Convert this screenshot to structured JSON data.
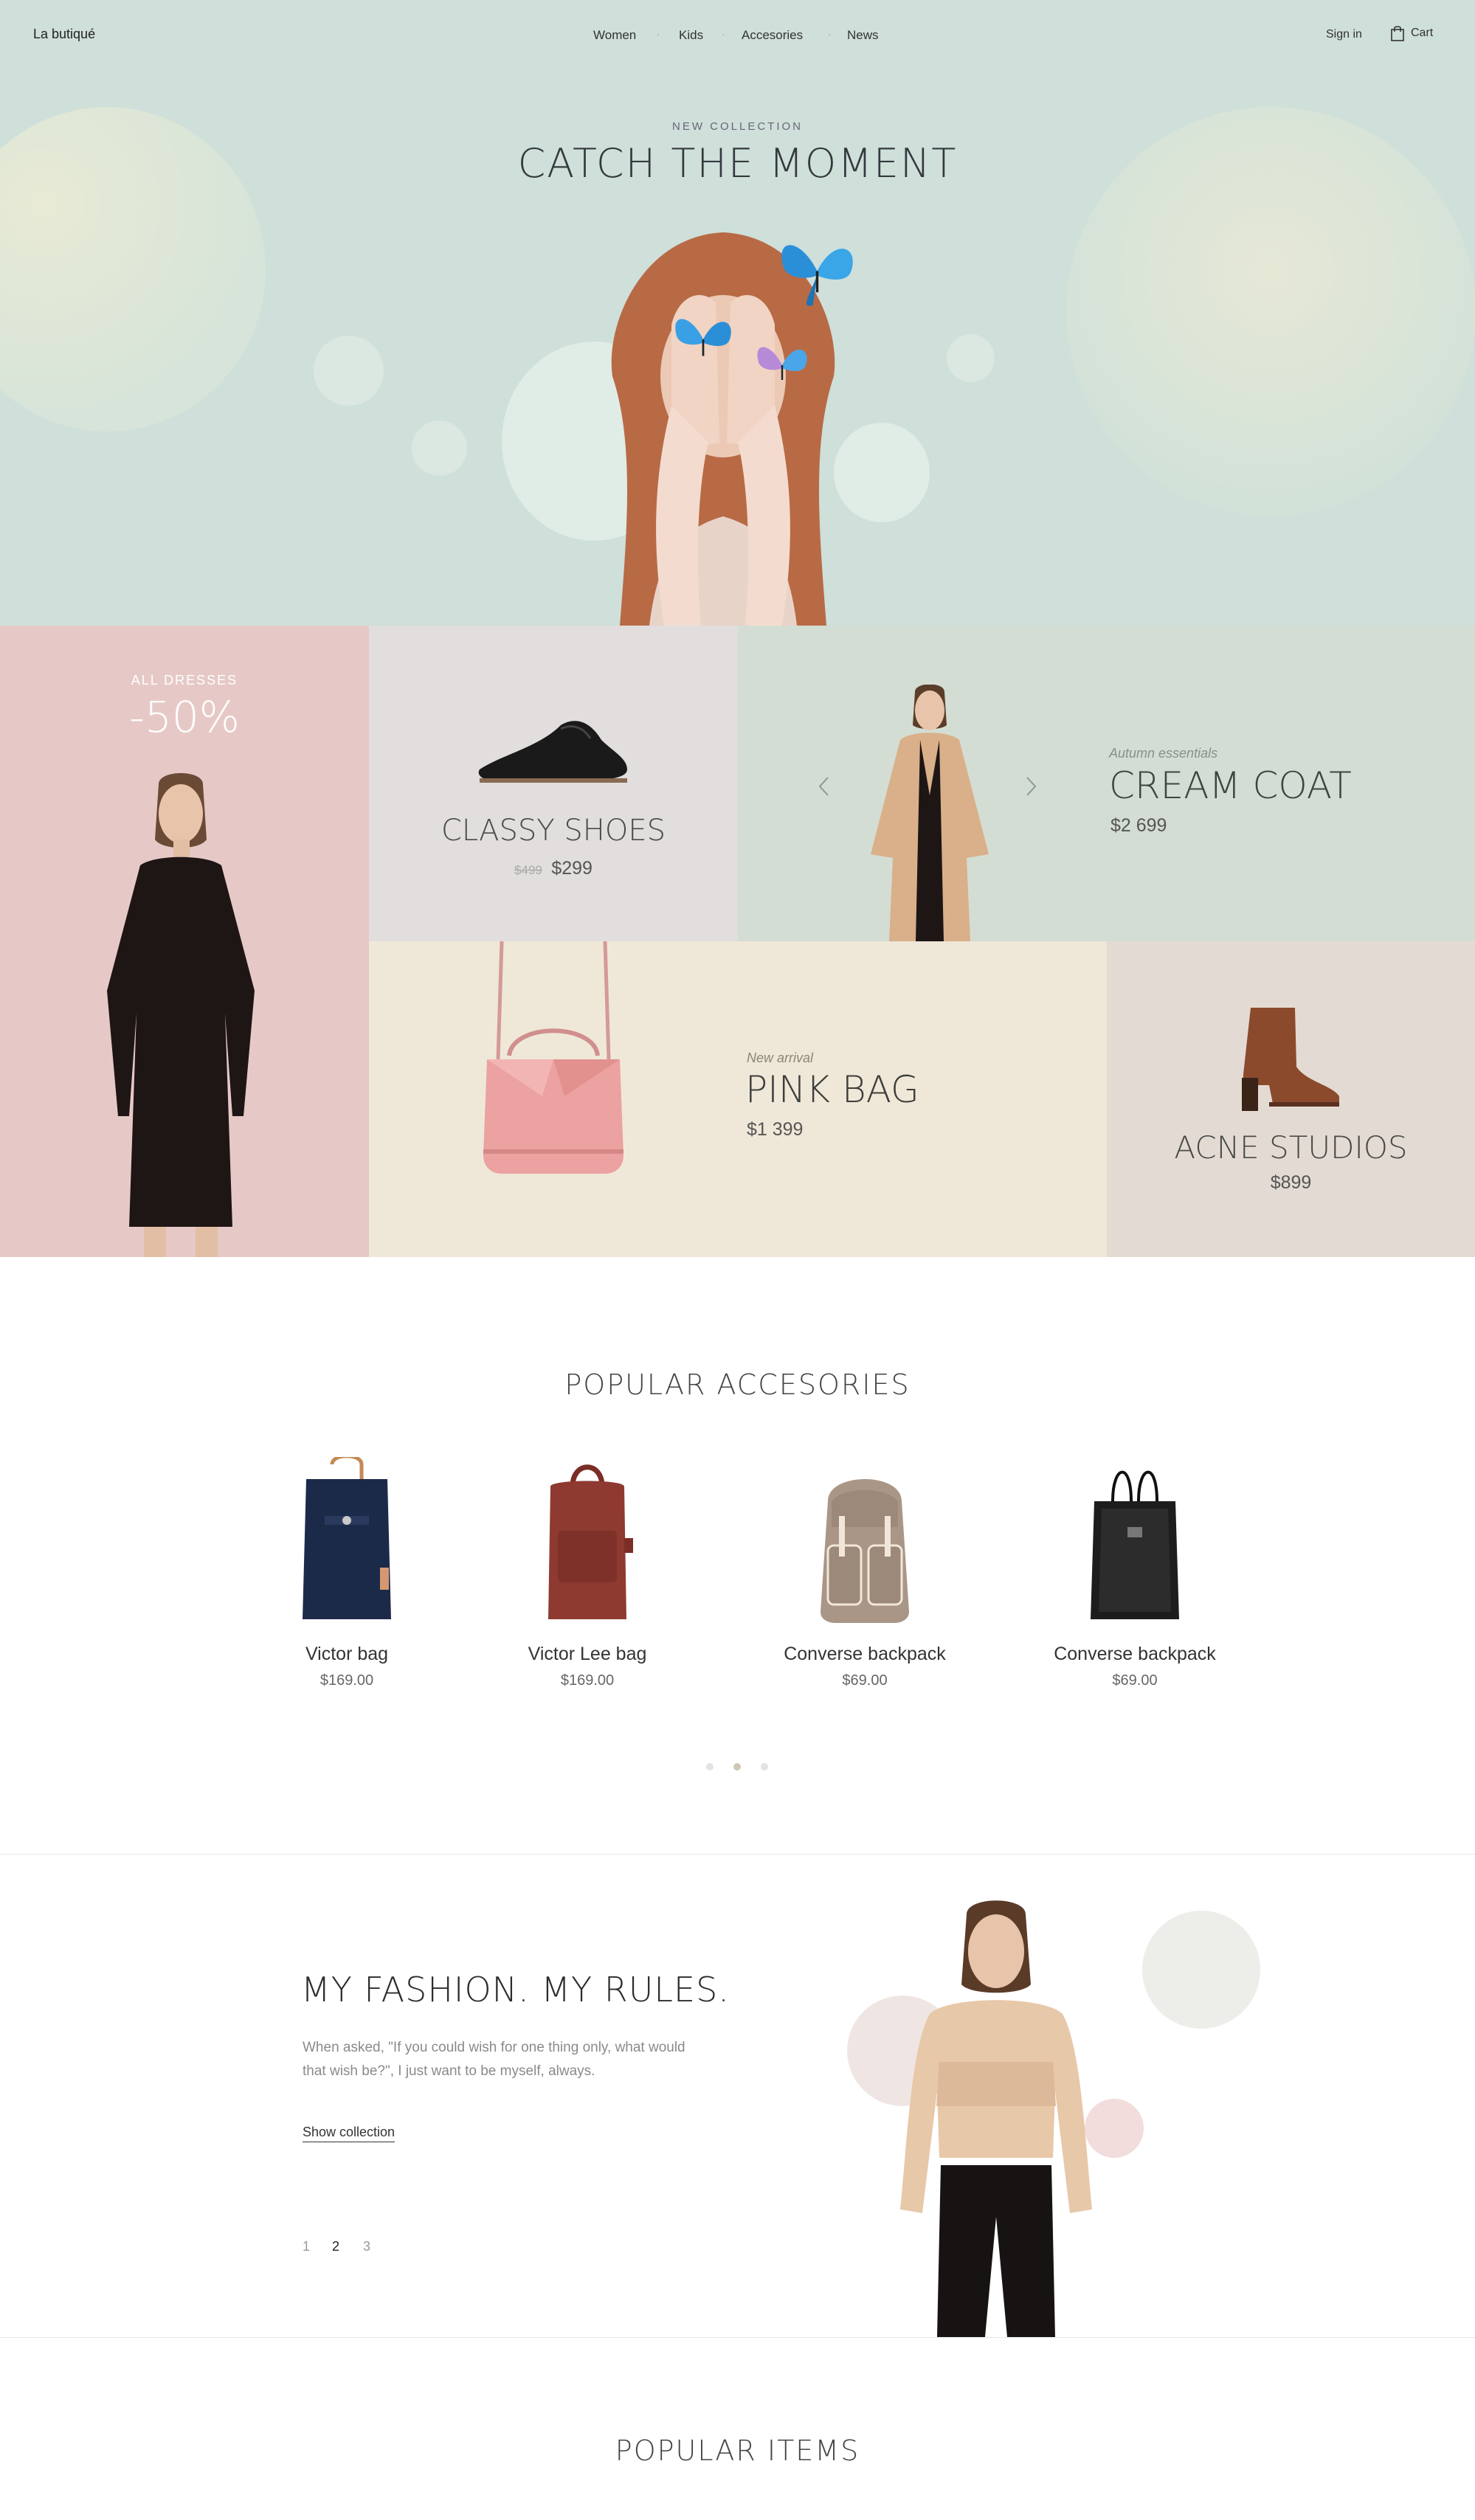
{
  "header": {
    "logo": "La butiqué",
    "nav": [
      "Women",
      "Kids",
      "Accesories",
      "News"
    ],
    "sign_in": "Sign in",
    "cart": "Cart"
  },
  "hero": {
    "kicker": "NEW COLLECTION",
    "title": "CATCH THE MOMENT"
  },
  "tiles": {
    "dresses": {
      "kicker": "ALL DRESSES",
      "discount": "-50%"
    },
    "shoes": {
      "title": "CLASSY SHOES",
      "old_price": "$499",
      "price": "$299"
    },
    "coat": {
      "kicker": "Autumn essentials",
      "title": "CREAM COAT",
      "price": "$2 699"
    },
    "bag": {
      "kicker": "New arrival",
      "title": "PINK BAG",
      "price": "$1 399"
    },
    "boots": {
      "title": "ACNE STUDIOS",
      "price": "$899"
    }
  },
  "accessories": {
    "title": "POPULAR ACCESORIES",
    "items": [
      {
        "name": "Victor bag",
        "price": "$169.00"
      },
      {
        "name": "Victor Lee bag",
        "price": "$169.00"
      },
      {
        "name": "Converse backpack",
        "price": "$69.00"
      },
      {
        "name": "Converse backpack",
        "price": "$69.00"
      }
    ]
  },
  "fashion": {
    "title": "MY FASHION. MY RULES.",
    "body_line1": "When asked, \"If you could wish for one thing only, what would",
    "body_line2": "that wish be?\", I just want to be myself, always.",
    "link": "Show collection",
    "pages": [
      "1",
      "2",
      "3"
    ]
  },
  "popular_items": {
    "title": "POPULAR ITEMS"
  },
  "colors": {
    "hero_bg": "#cfdfda",
    "dresses_bg": "#e6c9c6",
    "shoes_bg": "#e1dedd",
    "coat_bg": "#d4ddd3",
    "bag_bg": "#efe8d8",
    "boots_bg": "#e3dbd3"
  }
}
